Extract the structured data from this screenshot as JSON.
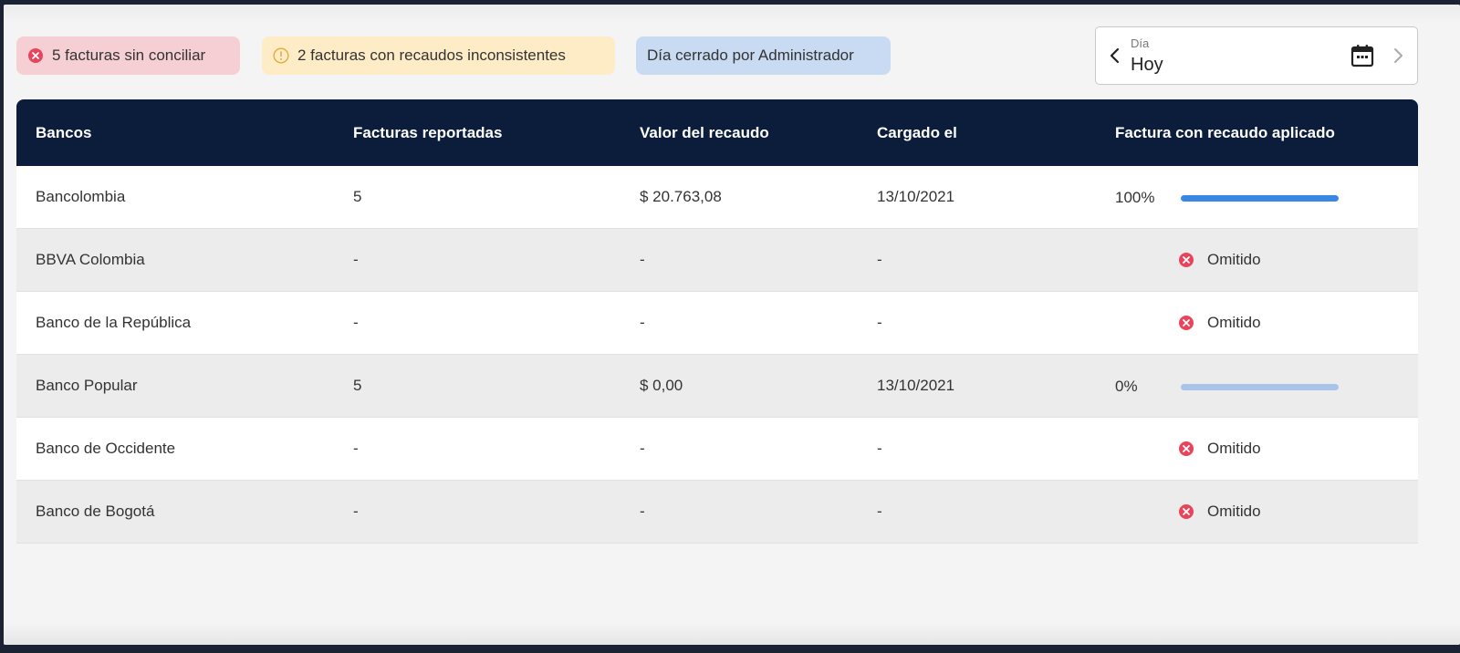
{
  "chips": {
    "error": {
      "text": "5 facturas sin conciliar",
      "icon": "error-circle-icon",
      "color": "#e8455c"
    },
    "warning": {
      "text": "2 facturas con recaudos inconsistentes",
      "icon": "info-circle-icon",
      "color": "#e9a93a"
    },
    "info": {
      "text": "Día cerrado por Administrador"
    }
  },
  "date_picker": {
    "label": "Día",
    "value": "Hoy"
  },
  "table": {
    "headers": [
      "Bancos",
      "Facturas reportadas",
      "Valor del recaudo",
      "Cargado el",
      "Factura con recaudo aplicado"
    ],
    "rows": [
      {
        "bank": "Bancolombia",
        "invoices": "5",
        "amount": "$ 20.763,08",
        "loaded": "13/10/2021",
        "applied_pct": "100%",
        "applied_value": 100
      },
      {
        "bank": "BBVA Colombia",
        "invoices": "-",
        "amount": "-",
        "loaded": "-",
        "status": "Omitido"
      },
      {
        "bank": "Banco de la República",
        "invoices": "-",
        "amount": "-",
        "loaded": "-",
        "status": "Omitido"
      },
      {
        "bank": "Banco Popular",
        "invoices": "5",
        "amount": "$ 0,00",
        "loaded": "13/10/2021",
        "applied_pct": "0%",
        "applied_value": 0
      },
      {
        "bank": "Banco de Occidente",
        "invoices": "-",
        "amount": "-",
        "loaded": "-",
        "status": "Omitido"
      },
      {
        "bank": "Banco de Bogotá",
        "invoices": "-",
        "amount": "-",
        "loaded": "-",
        "status": "Omitido"
      }
    ]
  },
  "colors": {
    "header_bg": "#0b1d3a",
    "progress_fill": "#3a86e3",
    "progress_track": "#a9c4e8",
    "omitted_icon": "#e8455c"
  }
}
